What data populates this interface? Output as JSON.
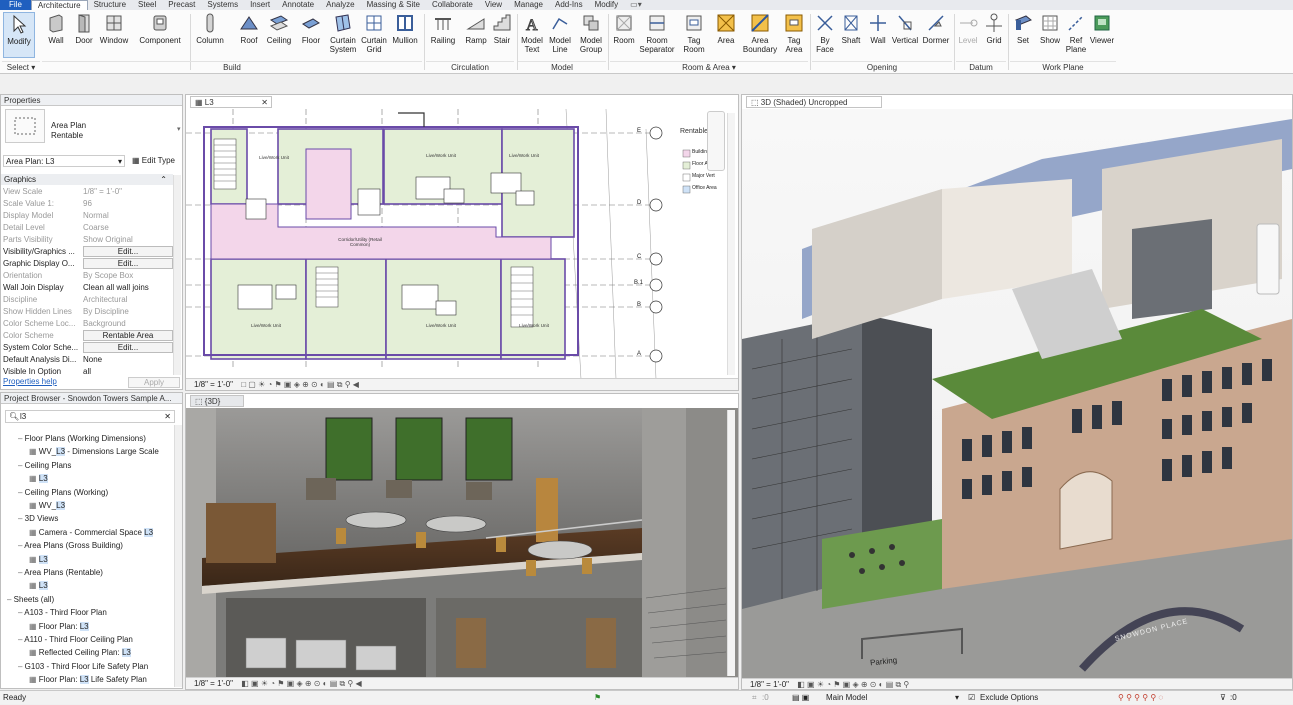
{
  "tabs": [
    "File",
    "Architecture",
    "Structure",
    "Steel",
    "Precast",
    "Systems",
    "Insert",
    "Annotate",
    "Analyze",
    "Massing & Site",
    "Collaborate",
    "View",
    "Manage",
    "Add-Ins",
    "Modify"
  ],
  "ribbon": {
    "buttons": {
      "modify": "Modify",
      "wall": "Wall",
      "door": "Door",
      "window": "Window",
      "component": "Component",
      "column": "Column",
      "roof": "Roof",
      "ceiling": "Ceiling",
      "floor": "Floor",
      "curtain_system": "Curtain System",
      "curtain_grid": "Curtain Grid",
      "mullion": "Mullion",
      "railing": "Railing",
      "ramp": "Ramp",
      "stair": "Stair",
      "model_text": "Model Text",
      "model_line": "Model Line",
      "model_group": "Model Group",
      "room": "Room",
      "room_separator": "Room Separator",
      "tag_room": "Tag Room",
      "area": "Area",
      "area_boundary": "Area Boundary",
      "tag_area": "Tag Area",
      "by_face": "By Face",
      "shaft": "Shaft",
      "wall_opening": "Wall",
      "vertical": "Vertical",
      "dormer": "Dormer",
      "level": "Level",
      "grid": "Grid",
      "set": "Set",
      "show": "Show",
      "ref_plane": "Ref Plane",
      "viewer": "Viewer"
    },
    "groups": {
      "select": "Select",
      "build": "Build",
      "circulation": "Circulation",
      "model": "Model",
      "room_area": "Room & Area",
      "opening": "Opening",
      "datum": "Datum",
      "work_plane": "Work Plane"
    }
  },
  "properties": {
    "title": "Properties",
    "type_name": "Area Plan",
    "type_sub": "Rentable",
    "selector": "Area Plan: L3",
    "edit_type": "Edit Type",
    "section": "Graphics",
    "rows": [
      {
        "k": "View Scale",
        "v": "1/8\" = 1'-0\"",
        "on": false
      },
      {
        "k": "Scale Value    1:",
        "v": "96",
        "on": false
      },
      {
        "k": "Display Model",
        "v": "Normal",
        "on": false
      },
      {
        "k": "Detail Level",
        "v": "Coarse",
        "on": false
      },
      {
        "k": "Parts Visibility",
        "v": "Show Original",
        "on": false
      },
      {
        "k": "Visibility/Graphics ...",
        "v": "Edit...",
        "on": true,
        "btn": true
      },
      {
        "k": "Graphic Display O...",
        "v": "Edit...",
        "on": true,
        "btn": true
      },
      {
        "k": "Orientation",
        "v": "By Scope Box",
        "on": false
      },
      {
        "k": "Wall Join Display",
        "v": "Clean all wall joins",
        "on": true
      },
      {
        "k": "Discipline",
        "v": "Architectural",
        "on": false
      },
      {
        "k": "Show Hidden Lines",
        "v": "By Discipline",
        "on": false
      },
      {
        "k": "Color Scheme Loc...",
        "v": "Background",
        "on": false
      },
      {
        "k": "Color Scheme",
        "v": "Rentable Area",
        "on": false,
        "btn": true
      },
      {
        "k": "System Color Sche...",
        "v": "Edit...",
        "on": true,
        "btn": true
      },
      {
        "k": "Default Analysis Di...",
        "v": "None",
        "on": true
      },
      {
        "k": "Visible In Option",
        "v": "all",
        "on": true
      }
    ],
    "help": "Properties help",
    "apply": "Apply"
  },
  "browser": {
    "title": "Project Browser - Snowdon Towers Sample A...",
    "search": "l3",
    "items": [
      {
        "t": "Floor Plans (Working Dimensions)",
        "lvl": 1
      },
      {
        "t": "WV_",
        "h": "L3",
        "a": " - Dimensions Large Scale",
        "lvl": 2
      },
      {
        "t": "Ceiling Plans",
        "lvl": 1
      },
      {
        "t": "",
        "h": "L3",
        "a": "",
        "lvl": 2
      },
      {
        "t": "Ceiling Plans (Working)",
        "lvl": 1
      },
      {
        "t": "WV_",
        "h": "L3",
        "a": "",
        "lvl": 2
      },
      {
        "t": "3D Views",
        "lvl": 1
      },
      {
        "t": "Camera - Commercial Space ",
        "h": "L3",
        "a": "",
        "lvl": 2
      },
      {
        "t": "Area Plans (Gross Building)",
        "lvl": 1
      },
      {
        "t": "",
        "h": "L3",
        "a": "",
        "lvl": 2
      },
      {
        "t": "Area Plans (Rentable)",
        "lvl": 1
      },
      {
        "t": "",
        "h": "L3",
        "a": "",
        "lvl": 2
      },
      {
        "t": "Sheets (all)",
        "lvl": 0
      },
      {
        "t": "A103 - Third Floor Plan",
        "lvl": 1
      },
      {
        "t": "Floor Plan: ",
        "h": "L3",
        "a": "",
        "lvl": 2
      },
      {
        "t": "A110 - Third Floor Ceiling Plan",
        "lvl": 1
      },
      {
        "t": "Reflected Ceiling Plan: ",
        "h": "L3",
        "a": "",
        "lvl": 2
      },
      {
        "t": "G103 - Third Floor Life Safety Plan",
        "lvl": 1
      },
      {
        "t": "Floor Plan: ",
        "h": "L3",
        "a": " Life Safety Plan",
        "lvl": 2
      }
    ]
  },
  "views": {
    "plan_tab": "L3",
    "persp_tab": "{3D}",
    "shaded_tab": "3D (Shaded) Uncropped",
    "plan_scale": "1/8\" = 1'-0\"",
    "persp_scale": "1/8\" = 1'-0\"",
    "shaded_scale": "1/8\" = 1'-0\"",
    "legend_title": "Rentable Ar",
    "legend_items": [
      "Building Co",
      "Floor Area",
      "Major Vert",
      "Office Area"
    ],
    "grid_bubbles": [
      "E",
      "D",
      "C",
      "B.1",
      "B",
      "A"
    ],
    "rooms": [
      "Live/Work Unit",
      "Live/Work Unit",
      "Live/Work Unit",
      "Live/Work Unit",
      "Live/Work Unit",
      "Live/Work Unit",
      "Corridor/Utility (Retail Common)"
    ],
    "parking": "Parking",
    "street_sign": "SNOWDON PLACE"
  },
  "status": {
    "ready": "Ready",
    "workset": ":0",
    "model": "Main Model",
    "exclude": "Exclude Options",
    "filter": ":0"
  },
  "colors": {
    "accent": "#1f5fbf",
    "rentable_green": "#e4efd7",
    "common_pink": "#f3d6ea",
    "wall_purple": "#6a4ba8"
  }
}
